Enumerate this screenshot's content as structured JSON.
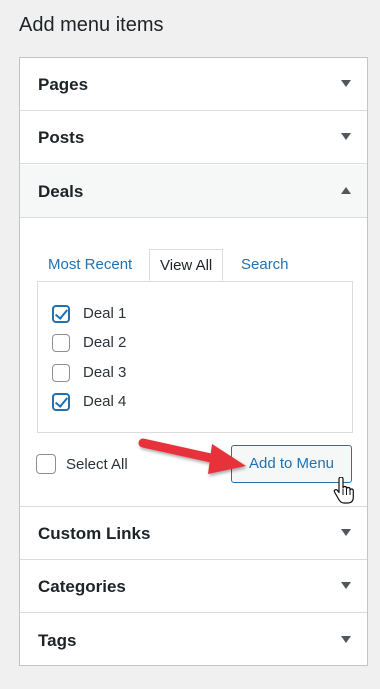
{
  "title": "Add menu items",
  "sections": {
    "pages": "Pages",
    "posts": "Posts",
    "deals": "Deals",
    "custom_links": "Custom Links",
    "categories": "Categories",
    "tags": "Tags"
  },
  "deals": {
    "tabs": [
      "Most Recent",
      "View All",
      "Search"
    ],
    "active_tab": "View All",
    "items": [
      {
        "label": "Deal 1",
        "checked": true
      },
      {
        "label": "Deal 2",
        "checked": false
      },
      {
        "label": "Deal 3",
        "checked": false
      },
      {
        "label": "Deal 4",
        "checked": true
      }
    ],
    "select_all_label": "Select All",
    "select_all_checked": false,
    "add_button_label": "Add to Menu"
  },
  "colors": {
    "accent": "#2271b1",
    "annotation_arrow": "#e8333b"
  },
  "icons": {
    "collapsed": "caret-down-icon",
    "expanded": "caret-up-icon",
    "annotation": "red-arrow-icon",
    "cursor": "hand-pointer-icon"
  }
}
